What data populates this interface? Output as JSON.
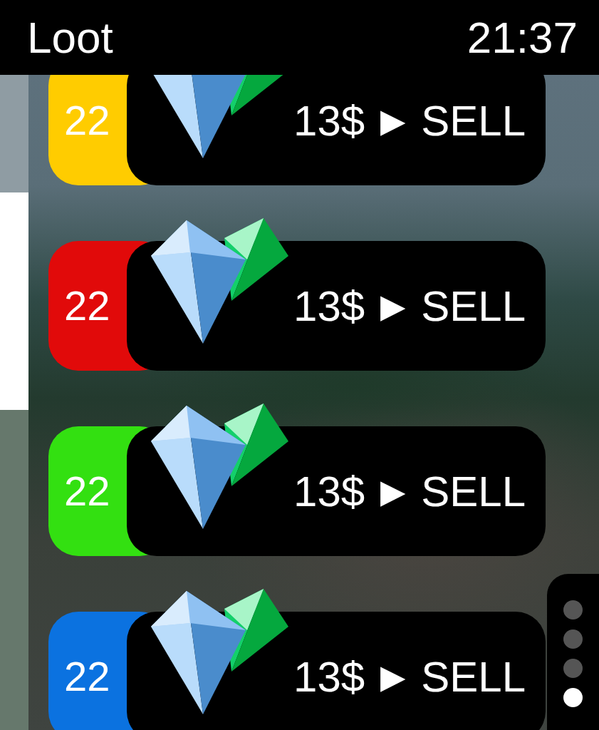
{
  "header": {
    "title": "Loot",
    "time": "21:37"
  },
  "items": [
    {
      "count": "22",
      "color": "#ffcc00",
      "price": "13$",
      "arrow": "▶",
      "action": "SELL"
    },
    {
      "count": "22",
      "color": "#e10a0a",
      "price": "13$",
      "arrow": "▶",
      "action": "SELL"
    },
    {
      "count": "22",
      "color": "#33e011",
      "price": "13$",
      "arrow": "▶",
      "action": "SELL"
    },
    {
      "count": "22",
      "color": "#0b72e0",
      "price": "13$",
      "arrow": "▶",
      "action": "SELL"
    }
  ],
  "page_indicator": [
    {
      "selected": false
    },
    {
      "selected": false
    },
    {
      "selected": false
    },
    {
      "selected": true
    }
  ]
}
